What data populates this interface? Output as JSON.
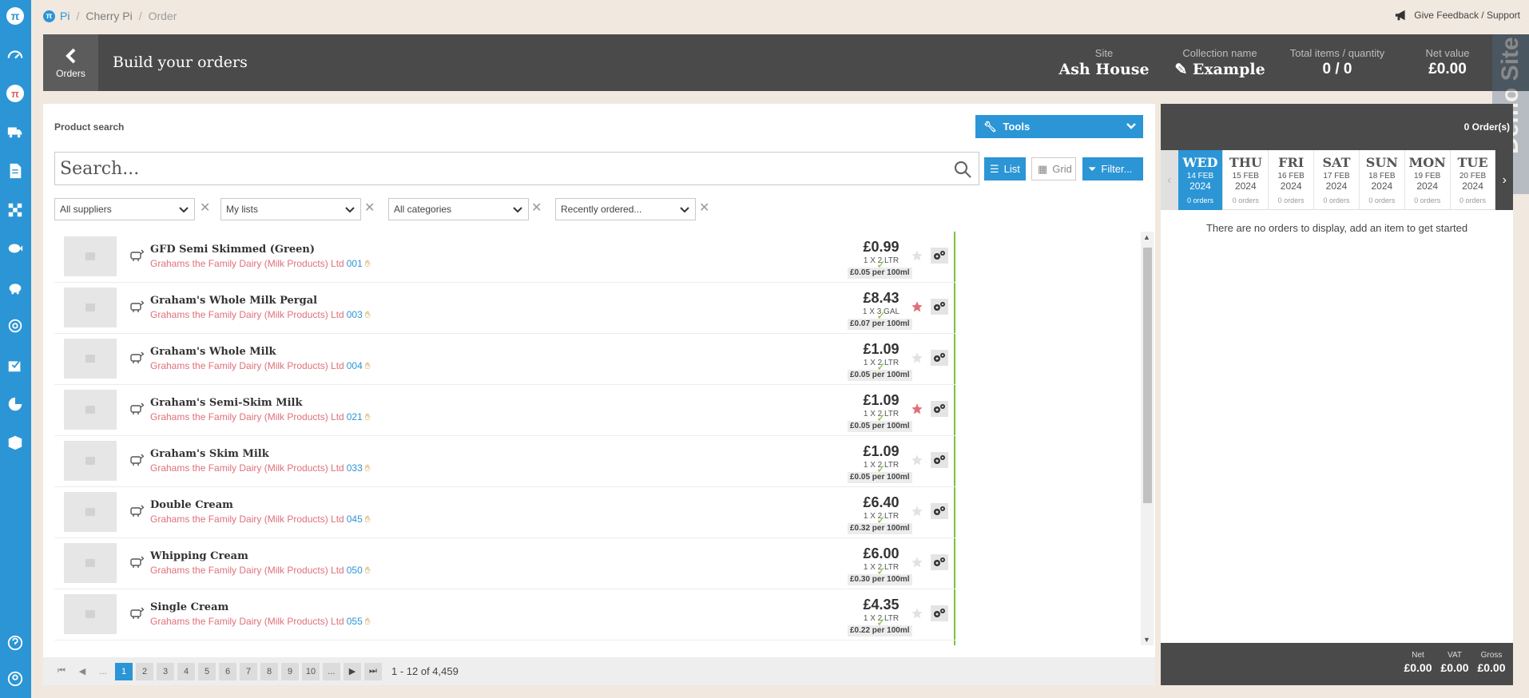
{
  "breadcrumb": {
    "logo": "π",
    "items": [
      "Pi",
      "Cherry Pi",
      "Order"
    ]
  },
  "feedback": "Give Feedback / Support",
  "header": {
    "back_label": "Orders",
    "title": "Build your orders",
    "site_label": "Site",
    "site_value": "Ash House",
    "collection_label": "Collection name",
    "collection_value": "Example",
    "total_label": "Total items / quantity",
    "total_value": "0 / 0",
    "net_label": "Net value",
    "net_value": "£0.00",
    "demo_tag": "Demo Site"
  },
  "product_panel": {
    "title": "Product search",
    "tools_label": "Tools",
    "search_placeholder": "Search...",
    "list_label": "List",
    "grid_label": "Grid",
    "filter_label": "Filter...",
    "filters": [
      "All suppliers",
      "My lists",
      "All categories",
      "Recently ordered..."
    ]
  },
  "products": [
    {
      "name": "GFD Semi Skimmed (Green)",
      "supplier": "Grahams the Family Dairy (Milk Products) Ltd",
      "code": "001",
      "price": "£0.99",
      "pack": "1 X 2 LTR",
      "per": "£0.05 per 100ml",
      "fav": false
    },
    {
      "name": "Graham's Whole Milk Pergal",
      "supplier": "Grahams the Family Dairy (Milk Products) Ltd",
      "code": "003",
      "price": "£8.43",
      "pack": "1 X 3 GAL",
      "per": "£0.07 per 100ml",
      "fav": true
    },
    {
      "name": "Graham's Whole Milk",
      "supplier": "Grahams the Family Dairy (Milk Products) Ltd",
      "code": "004",
      "price": "£1.09",
      "pack": "1 X 2 LTR",
      "per": "£0.05 per 100ml",
      "fav": false
    },
    {
      "name": "Graham's Semi-Skim Milk",
      "supplier": "Grahams the Family Dairy (Milk Products) Ltd",
      "code": "021",
      "price": "£1.09",
      "pack": "1 X 2 LTR",
      "per": "£0.05 per 100ml",
      "fav": true
    },
    {
      "name": "Graham's Skim Milk",
      "supplier": "Grahams the Family Dairy (Milk Products) Ltd",
      "code": "033",
      "price": "£1.09",
      "pack": "1 X 2 LTR",
      "per": "£0.05 per 100ml",
      "fav": false
    },
    {
      "name": "Double Cream",
      "supplier": "Grahams the Family Dairy (Milk Products) Ltd",
      "code": "045",
      "price": "£6.40",
      "pack": "1 X 2 LTR",
      "per": "£0.32 per 100ml",
      "fav": false
    },
    {
      "name": "Whipping Cream",
      "supplier": "Grahams the Family Dairy (Milk Products) Ltd",
      "code": "050",
      "price": "£6.00",
      "pack": "1 X 2 LTR",
      "per": "£0.30 per 100ml",
      "fav": false
    },
    {
      "name": "Single Cream",
      "supplier": "Grahams the Family Dairy (Milk Products) Ltd",
      "code": "055",
      "price": "£4.35",
      "pack": "1 X 2 LTR",
      "per": "£0.22 per 100ml",
      "fav": false
    }
  ],
  "pager": {
    "pages": [
      "1",
      "2",
      "3",
      "4",
      "5",
      "6",
      "7",
      "8",
      "9",
      "10"
    ],
    "current": "1",
    "ellipsis": "...",
    "info": "1 - 12 of 4,459"
  },
  "orders": {
    "count": "0 Order(s)",
    "days": [
      {
        "name": "WED",
        "date": "14 FEB",
        "year": "2024",
        "orders": "0 orders",
        "selected": true
      },
      {
        "name": "THU",
        "date": "15 FEB",
        "year": "2024",
        "orders": "0 orders",
        "selected": false
      },
      {
        "name": "FRI",
        "date": "16 FEB",
        "year": "2024",
        "orders": "0 orders",
        "selected": false
      },
      {
        "name": "SAT",
        "date": "17 FEB",
        "year": "2024",
        "orders": "0 orders",
        "selected": false
      },
      {
        "name": "SUN",
        "date": "18 FEB",
        "year": "2024",
        "orders": "0 orders",
        "selected": false
      },
      {
        "name": "MON",
        "date": "19 FEB",
        "year": "2024",
        "orders": "0 orders",
        "selected": false
      },
      {
        "name": "TUE",
        "date": "20 FEB",
        "year": "2024",
        "orders": "0 orders",
        "selected": false
      }
    ],
    "empty": "There are no orders to display, add an item to get started",
    "net_label": "Net",
    "net_value": "£0.00",
    "vat_label": "VAT",
    "vat_value": "£0.00",
    "gross_label": "Gross",
    "gross_value": "£0.00"
  },
  "colors": {
    "brand": "#2b95d6",
    "add_green": "#7dc13d",
    "supplier_pink": "#e0707a",
    "header_dark": "#4a4a4a"
  },
  "icons": {
    "add": "+",
    "tick": "✓"
  }
}
